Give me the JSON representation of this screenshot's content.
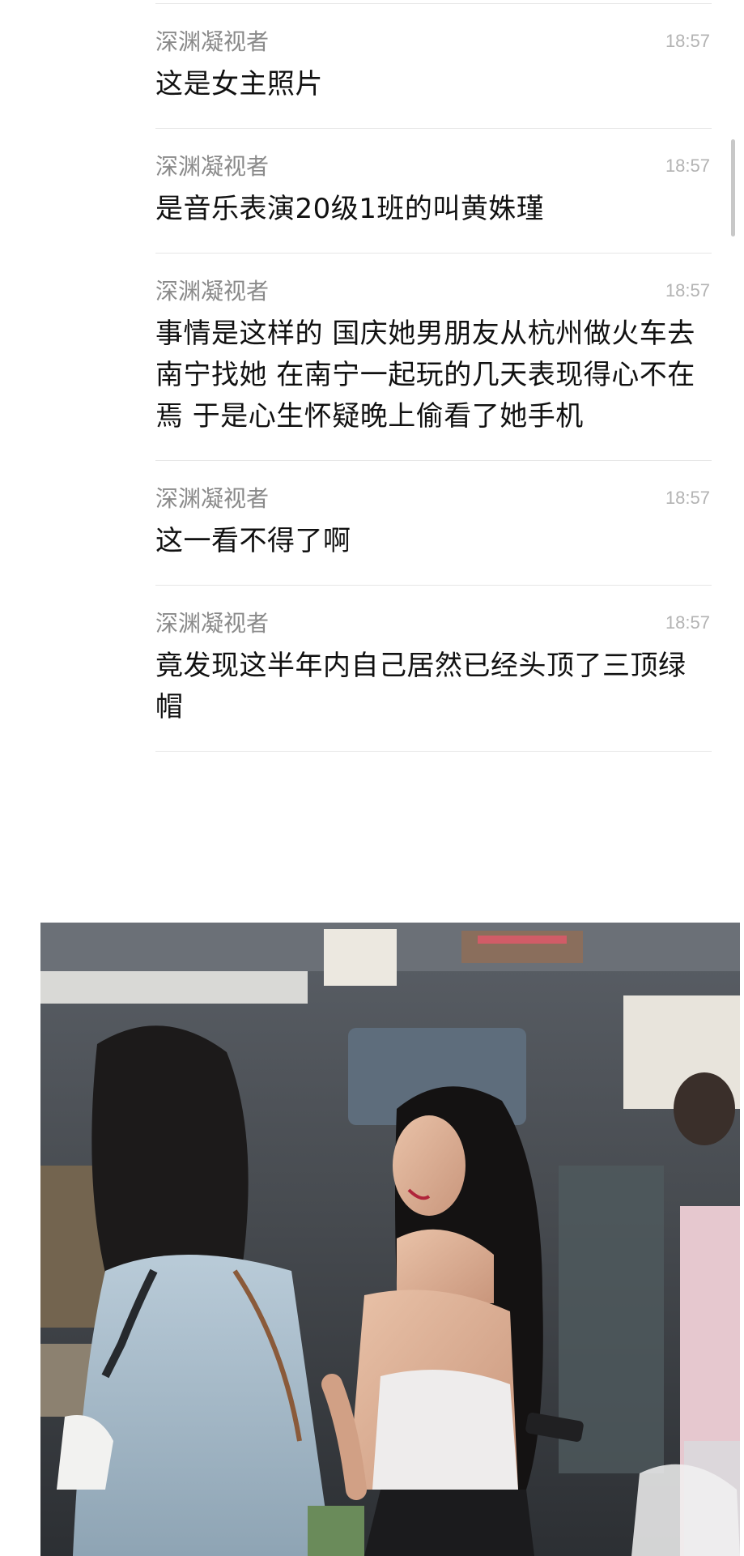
{
  "messages": [
    {
      "sender": "深渊凝视者",
      "time": "18:57",
      "text": "这是女主照片"
    },
    {
      "sender": "深渊凝视者",
      "time": "18:57",
      "text": "是音乐表演20级1班的叫黄姝瑾"
    },
    {
      "sender": "深渊凝视者",
      "time": "18:57",
      "text": "事情是这样的 国庆她男朋友从杭州做火车去南宁找她 在南宁一起玩的几天表现得心不在焉  于是心生怀疑晚上偷看了她手机"
    },
    {
      "sender": "深渊凝视者",
      "time": "18:57",
      "text": "这一看不得了啊"
    },
    {
      "sender": "深渊凝视者",
      "time": "18:57",
      "text": "竟发现这半年内自己居然已经头顶了三顶绿帽"
    }
  ],
  "colors": {
    "sender": "#8a8a8a",
    "time": "#b3b3b3",
    "text": "#111111",
    "divider": "#e6e6e6"
  }
}
